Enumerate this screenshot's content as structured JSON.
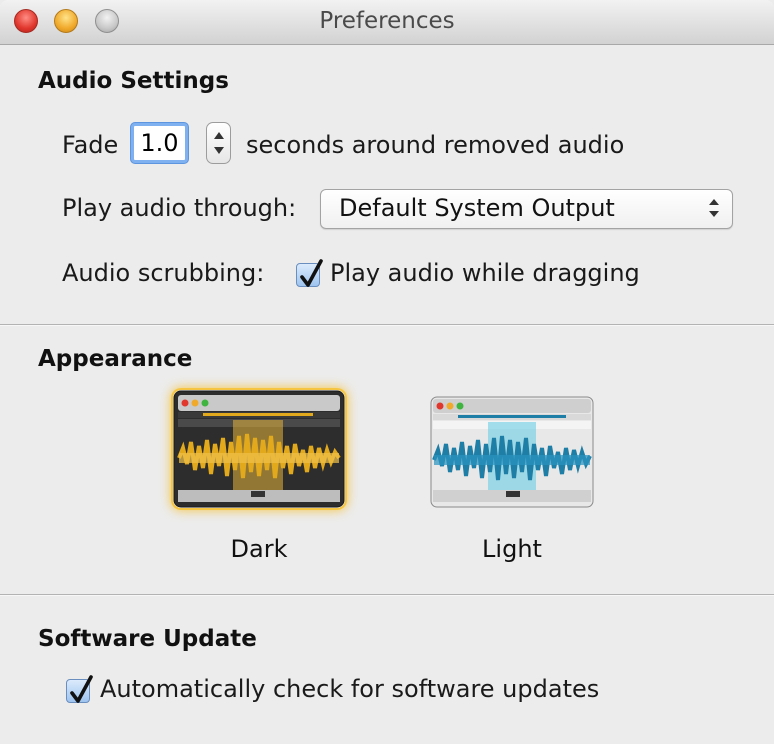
{
  "window": {
    "title": "Preferences"
  },
  "audio": {
    "section_title": "Audio Settings",
    "fade_label": "Fade",
    "fade_value": "1.0",
    "fade_suffix": "seconds around removed audio",
    "play_through_label": "Play audio through:",
    "play_through_value": "Default System Output",
    "scrubbing_label": "Audio scrubbing:",
    "scrubbing_checkbox_label": "Play audio while dragging",
    "scrubbing_checked": true
  },
  "appearance": {
    "section_title": "Appearance",
    "options": [
      {
        "label": "Dark",
        "selected": true
      },
      {
        "label": "Light",
        "selected": false
      }
    ],
    "colors": {
      "dark_wave": "#e2a91c",
      "light_wave": "#1e7ea6",
      "selection_glow": "#f6c643"
    }
  },
  "update": {
    "section_title": "Software Update",
    "auto_check_label": "Automatically check for software updates",
    "auto_check_checked": true
  }
}
